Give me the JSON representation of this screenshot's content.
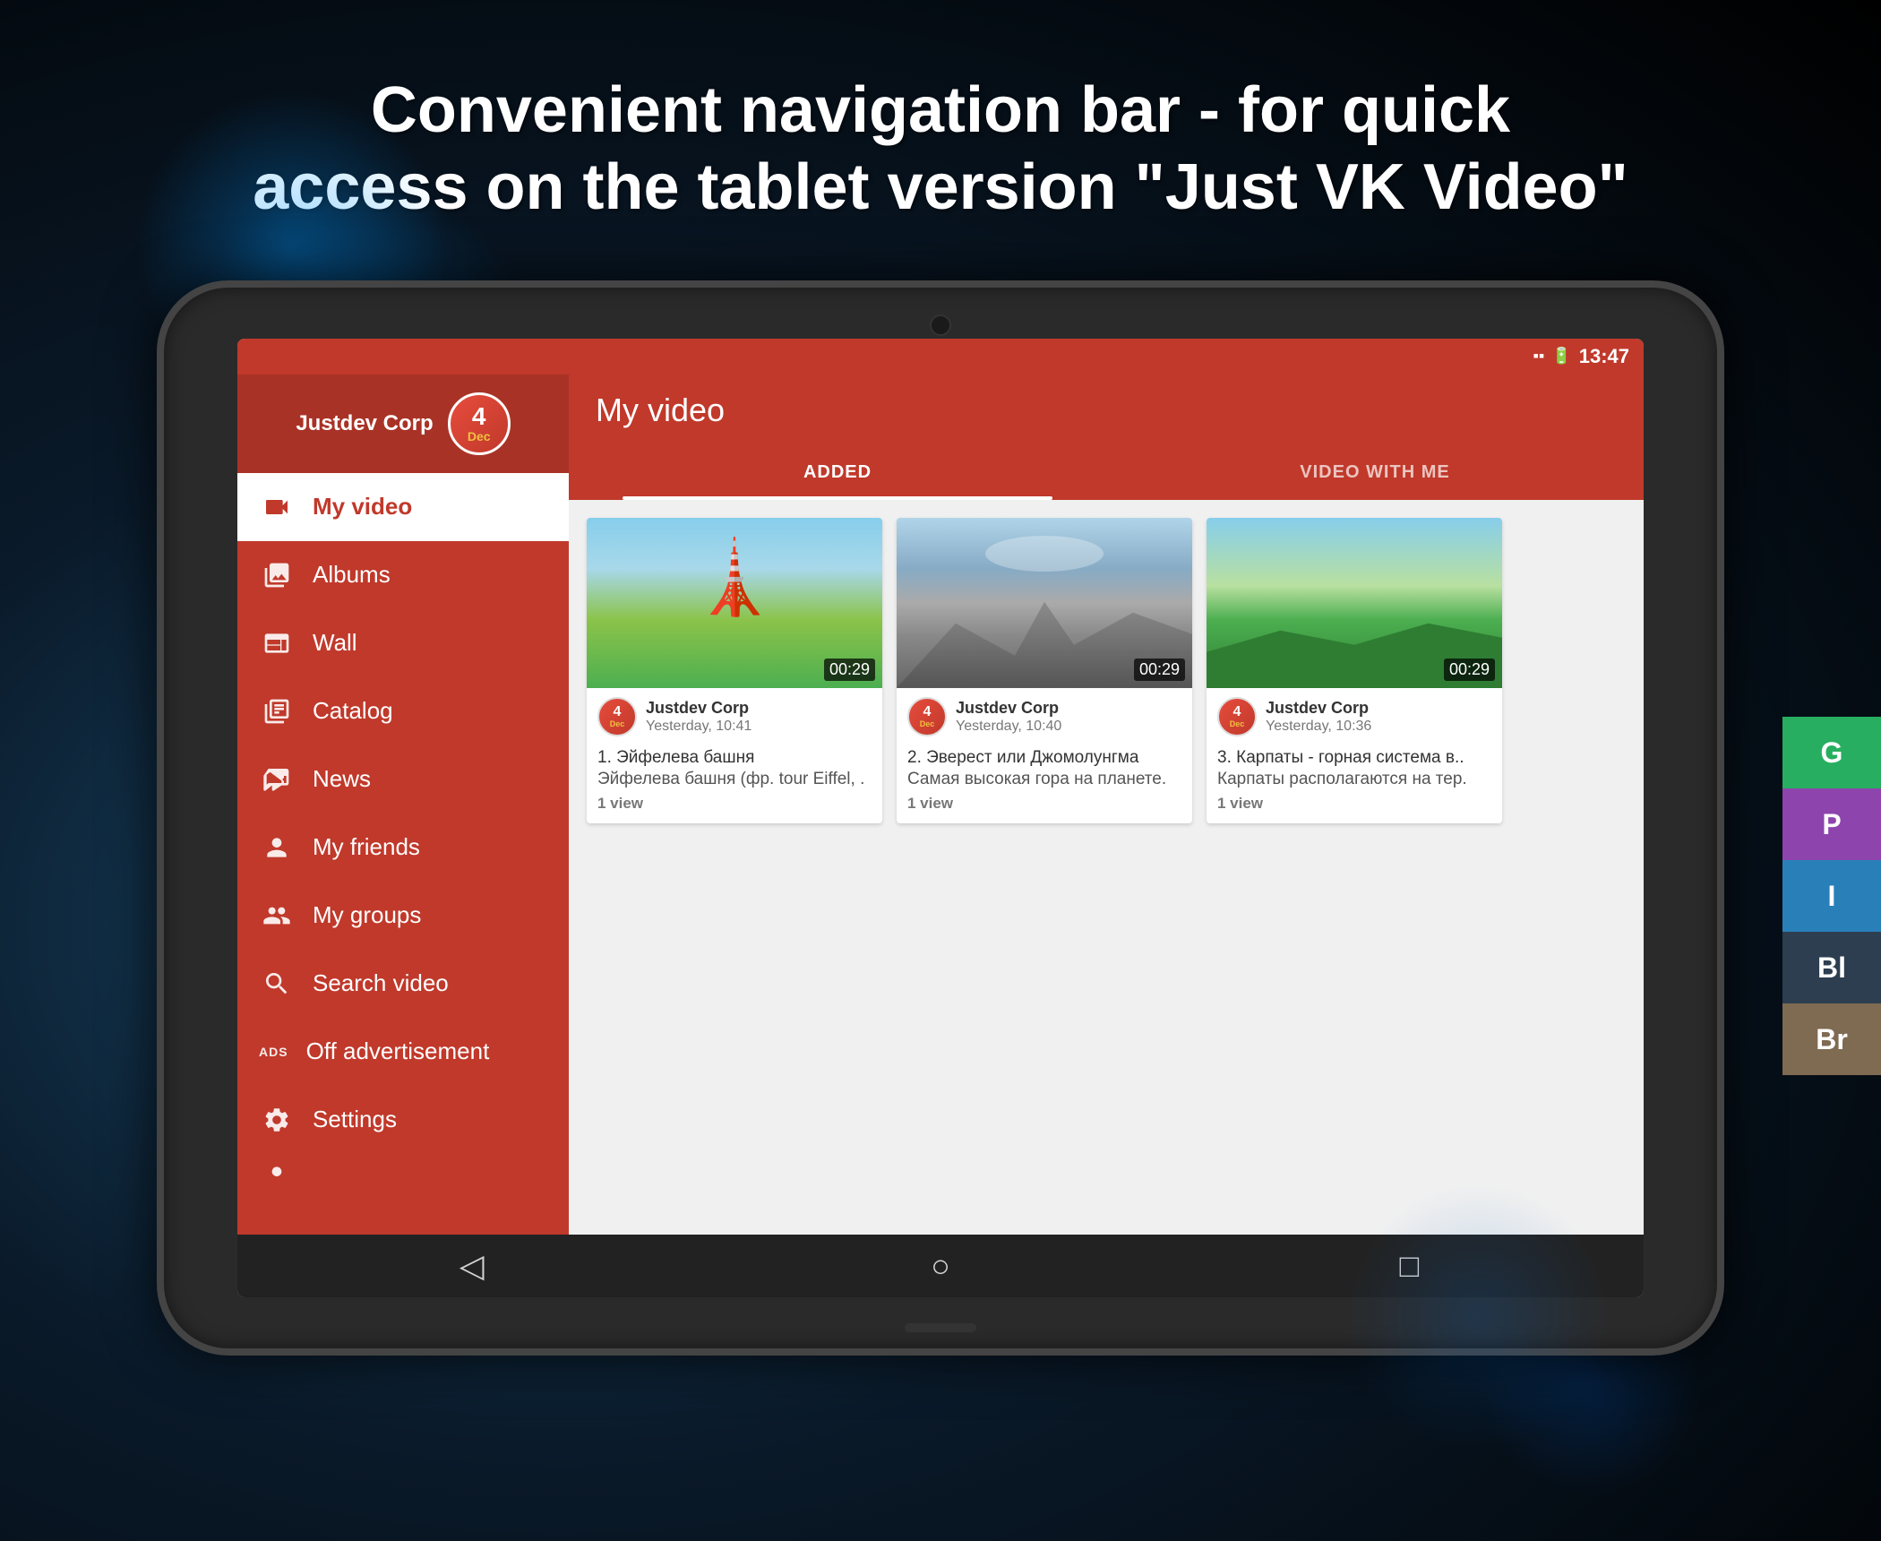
{
  "headline": {
    "line1": "Convenient navigation bar - for quick",
    "line2": "access on the tablet version \"Just VK Video\""
  },
  "statusBar": {
    "time": "13:47",
    "icons": [
      "signal",
      "battery"
    ]
  },
  "sidebar": {
    "userName": "Justdev Corp",
    "avatarNumber": "4",
    "avatarText": "Dec",
    "navItems": [
      {
        "id": "my-video",
        "label": "My video",
        "icon": "video",
        "active": true
      },
      {
        "id": "albums",
        "label": "Albums",
        "icon": "albums",
        "active": false
      },
      {
        "id": "wall",
        "label": "Wall",
        "icon": "wall",
        "active": false
      },
      {
        "id": "catalog",
        "label": "Catalog",
        "icon": "catalog",
        "active": false
      },
      {
        "id": "news",
        "label": "News",
        "icon": "news",
        "active": false
      },
      {
        "id": "my-friends",
        "label": "My friends",
        "icon": "friends",
        "active": false
      },
      {
        "id": "my-groups",
        "label": "My groups",
        "icon": "groups",
        "active": false
      },
      {
        "id": "search-video",
        "label": "Search video",
        "icon": "search",
        "active": false
      },
      {
        "id": "off-advertisement",
        "label": "Off advertisement",
        "icon": "ads",
        "active": false
      },
      {
        "id": "settings",
        "label": "Settings",
        "icon": "settings",
        "active": false
      }
    ]
  },
  "content": {
    "title": "My video",
    "tabs": [
      {
        "id": "added",
        "label": "ADDED",
        "active": true
      },
      {
        "id": "video-with-me",
        "label": "VIDEO WITH ME",
        "active": false
      }
    ],
    "videos": [
      {
        "id": 1,
        "channelName": "Justdev Corp",
        "time": "Yesterday, 10:41",
        "duration": "00:29",
        "title": "1. Эйфелева башня",
        "description": "Эйфелева башня (фр. tour Eiffel, .",
        "views": "1 view",
        "thumbnail": "eiffel"
      },
      {
        "id": 2,
        "channelName": "Justdev Corp",
        "time": "Yesterday, 10:40",
        "duration": "00:29",
        "title": "2. Эверест или Джомолунгма",
        "description": "Самая высокая гора на планете.",
        "views": "1 view",
        "thumbnail": "mountain"
      },
      {
        "id": 3,
        "channelName": "Justdev Corp",
        "time": "Yesterday, 10:36",
        "duration": "00:29",
        "title": "3. Карпаты - горная система в..",
        "description": "Карпаты располагаются на тер.",
        "views": "1 view",
        "thumbnail": "hills"
      }
    ]
  },
  "bottomNav": {
    "buttons": [
      "back",
      "home",
      "recent"
    ]
  },
  "swatches": [
    {
      "label": "G",
      "color": "#27ae60"
    },
    {
      "label": "P",
      "color": "#8e44ad"
    },
    {
      "label": "I",
      "color": "#2980b9"
    },
    {
      "label": "Bl",
      "color": "#2c3e50"
    },
    {
      "label": "Br",
      "color": "#7f6a52"
    }
  ]
}
